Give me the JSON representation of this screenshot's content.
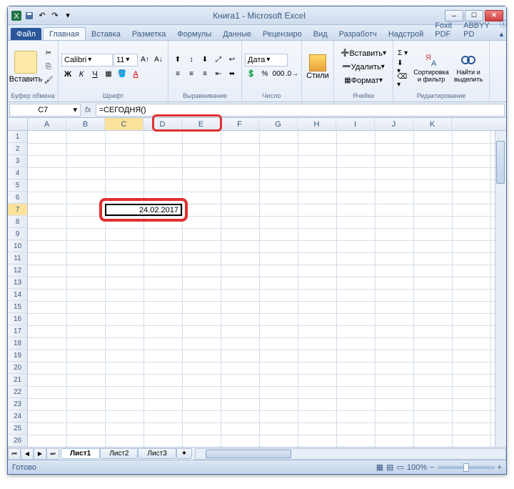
{
  "window_title": "Книга1 - Microsoft Excel",
  "tabs": {
    "file": "Файл",
    "items": [
      "Главная",
      "Вставка",
      "Разметка",
      "Формулы",
      "Данные",
      "Рецензиро",
      "Вид",
      "Разработч",
      "Надстрой",
      "Foxit PDF",
      "ABBYY PD"
    ],
    "active": "Главная"
  },
  "ribbon": {
    "paste": "Вставить",
    "clipboard": "Буфер обмена",
    "font_name": "Calibri",
    "font_size": "11",
    "font_group": "Шрифт",
    "align_group": "Выравнивание",
    "number_format": "Дата",
    "number_group": "Число",
    "styles": "Стили",
    "cells_insert": "Вставить",
    "cells_delete": "Удалить",
    "cells_format": "Формат",
    "cells_group": "Ячейки",
    "sort_filter": "Сортировка и фильтр",
    "find_select": "Найти и выделить",
    "editing_group": "Редактирование"
  },
  "namebox": "C7",
  "formula": "=СЕГОДНЯ()",
  "columns": [
    "A",
    "B",
    "C",
    "D",
    "E",
    "F",
    "G",
    "H",
    "I",
    "J",
    "K"
  ],
  "active_col": "C",
  "active_row": 7,
  "cell_value": "24.02.2017",
  "sheets": [
    "Лист1",
    "Лист2",
    "Лист3"
  ],
  "active_sheet": "Лист1",
  "status": "Готово",
  "zoom": "100%"
}
